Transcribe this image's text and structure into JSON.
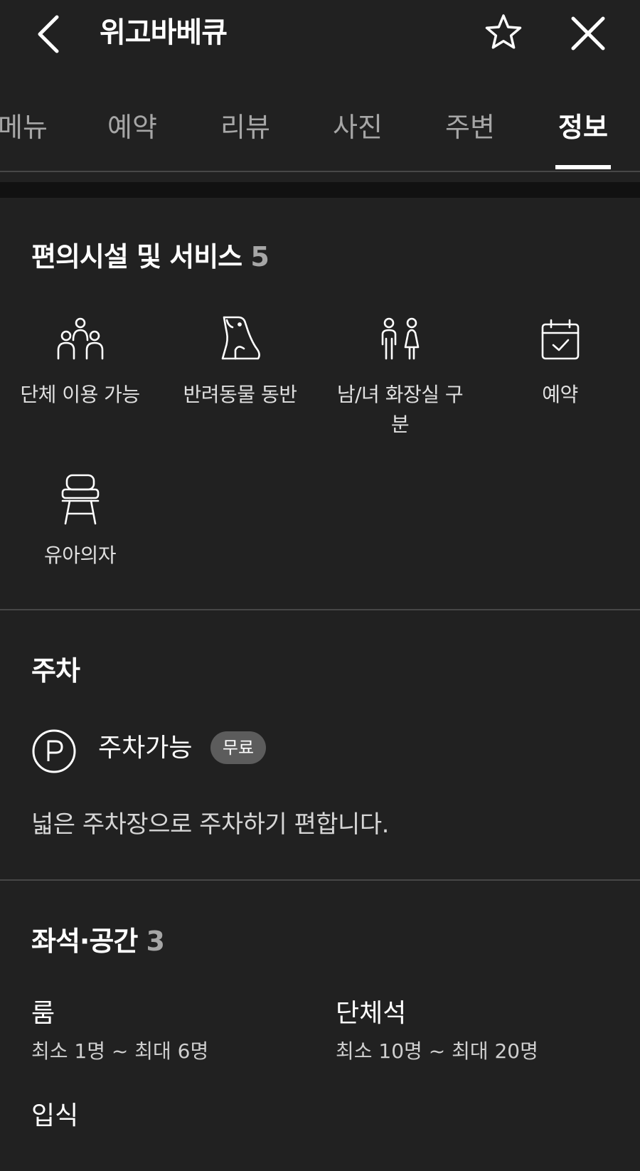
{
  "header": {
    "title": "위고바베큐",
    "back_icon": "chevron-left-icon",
    "favorite_icon": "star-outline-icon",
    "close_icon": "close-icon"
  },
  "tabs": [
    {
      "label": "메뉴",
      "active": false
    },
    {
      "label": "예약",
      "active": false
    },
    {
      "label": "리뷰",
      "active": false
    },
    {
      "label": "사진",
      "active": false
    },
    {
      "label": "주변",
      "active": false
    },
    {
      "label": "정보",
      "active": true
    }
  ],
  "facilities": {
    "title": "편의시설 및 서비스",
    "count": "5",
    "items": [
      {
        "label": "단체 이용 가능",
        "icon": "group-people-icon"
      },
      {
        "label": "반려동물 동반",
        "icon": "pet-dog-icon"
      },
      {
        "label": "남/녀 화장실 구분",
        "icon": "restroom-icon"
      },
      {
        "label": "예약",
        "icon": "calendar-check-icon"
      },
      {
        "label": "유아의자",
        "icon": "high-chair-icon"
      }
    ]
  },
  "parking": {
    "title": "주차",
    "status": "주차가능",
    "badge": "무료",
    "description": "넓은 주차장으로 주차하기 편합니다.",
    "icon": "parking-p-icon"
  },
  "seating": {
    "title": "좌석·공간",
    "count": "3",
    "items": [
      {
        "name": "룸",
        "range": "최소 1명 ~ 최대 6명"
      },
      {
        "name": "단체석",
        "range": "최소 10명 ~ 최대 20명"
      },
      {
        "name": "입식",
        "range": ""
      }
    ]
  },
  "colors": {
    "background": "#212121",
    "text_primary": "#ffffff",
    "text_secondary": "#a6a6a6",
    "divider": "#474747",
    "badge_bg": "#5c5c5c"
  }
}
